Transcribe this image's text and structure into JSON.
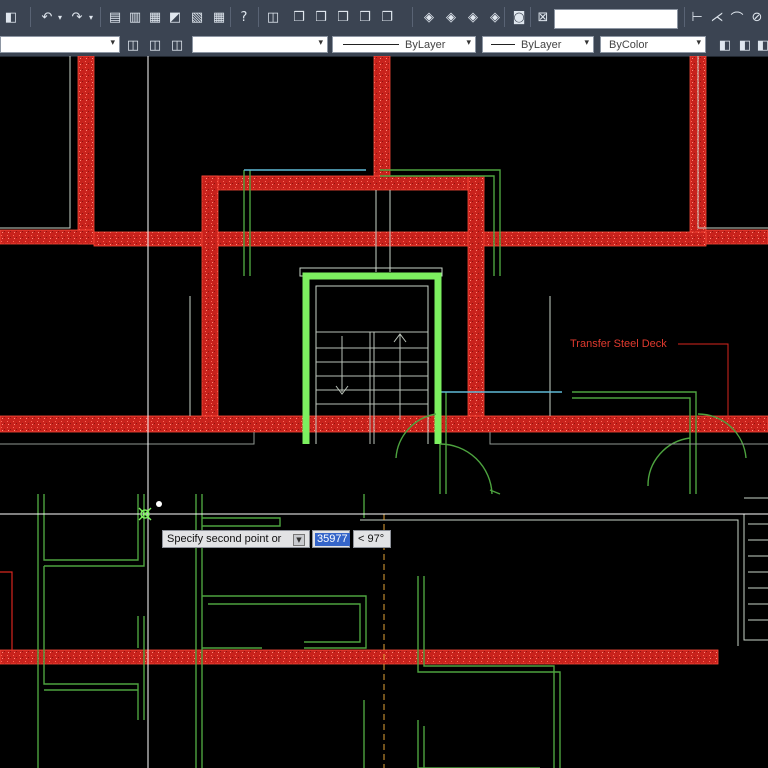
{
  "toolbar": {
    "icons": [
      "hatch-icon",
      "undo-icon",
      "redo-icon",
      "save-icon",
      "print-icon",
      "properties-icon",
      "match-icon",
      "paste-icon",
      "table-icon",
      "help-icon",
      "layer-icon",
      "view-front-icon",
      "view-top-icon",
      "view-left-icon",
      "view-right-icon",
      "view-back-icon",
      "orbit-1-icon",
      "orbit-2-icon",
      "orbit-3-icon",
      "orbit-4-icon",
      "camera-icon",
      "zoom-extents-icon",
      "dim-linear-icon",
      "dim-aligned-icon",
      "dim-arc-icon",
      "dim-radius-icon"
    ],
    "search_value": ""
  },
  "properties_bar": {
    "layer_value": "",
    "linetype": "ByLayer",
    "lineweight": "ByLayer",
    "color": "ByColor"
  },
  "command": {
    "prompt": "Specify second point or",
    "distance": "35977",
    "angle": "< 97°"
  },
  "annotation": {
    "label": "Transfer Steel Deck"
  },
  "colors": {
    "wall_red": "#d7261e",
    "highlight_green": "#7cf05f",
    "linework_green": "#4da33f",
    "cyan": "#5fb9d6",
    "crosshair": "#ffffff",
    "tracking": "#e3a437"
  }
}
